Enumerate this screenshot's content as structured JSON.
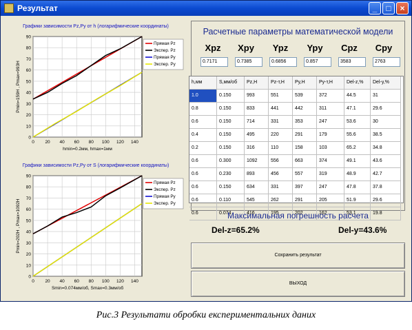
{
  "window": {
    "title": "Результат"
  },
  "titlebar_buttons": {
    "minimize": "_",
    "maximize": "□",
    "close": "×"
  },
  "chart_top": {
    "title": "Графики зависимости Pz,Py от h (логарифмические координаты)",
    "ylabel": "Pmin=159Н , Pmax=993Н",
    "xlabel": "hmin=0.2мм, hmax=1мм",
    "xticks": [
      "0",
      "20",
      "40",
      "60",
      "80",
      "100",
      "120",
      "140"
    ],
    "yticks": [
      "90",
      "80",
      "70",
      "60",
      "50",
      "40",
      "30",
      "20",
      "10",
      "0"
    ],
    "legend": [
      "Прямая Pz",
      "Экспер. Pz",
      "Прямая Py",
      "Экспер. Py"
    ]
  },
  "chart_bottom": {
    "title": "Графики зависимости Pz,Py от S (логарифмические координаты)",
    "ylabel": "Pmin=202Н , Pmax=1092Н",
    "xlabel": "Smin=0.074мм/об, Smax=0.3мм/об",
    "xticks": [
      "0",
      "20",
      "40",
      "60",
      "80",
      "100",
      "120",
      "140"
    ],
    "yticks": [
      "90",
      "80",
      "70",
      "60",
      "50",
      "40",
      "30",
      "20",
      "10",
      "0"
    ],
    "legend": [
      "Прямая Pz",
      "Экспер. Pz",
      "Прямая Py",
      "Экспер. Py"
    ]
  },
  "chart_data": [
    {
      "type": "line",
      "title": "Графики зависимости Pz,Py от h (логарифмические координаты)",
      "xlabel": "hmin=0.2мм, hmax=1мм",
      "ylabel": "Pmin=159Н , Pmax=993Н",
      "xlim": [
        0,
        150
      ],
      "ylim": [
        0,
        90
      ],
      "grid": true,
      "legend": "top-right",
      "series": [
        {
          "name": "Прямая Pz",
          "color": "#e00000",
          "x": [
            0,
            150
          ],
          "y": [
            34,
            90
          ]
        },
        {
          "name": "Экспер. Pz",
          "color": "#000000",
          "x": [
            0,
            20,
            40,
            60,
            80,
            100,
            120,
            150
          ],
          "y": [
            34,
            40,
            48,
            55,
            64,
            73,
            79,
            90
          ]
        },
        {
          "name": "Прямая Py",
          "color": "#1010d0",
          "x": [
            0,
            150
          ],
          "y": [
            0,
            58
          ]
        },
        {
          "name": "Экспер. Py",
          "color": "#e8e800",
          "x": [
            0,
            30,
            60,
            90,
            120,
            150
          ],
          "y": [
            0,
            12,
            23,
            35,
            46,
            58
          ]
        }
      ]
    },
    {
      "type": "line",
      "title": "Графики зависимости Pz,Py от S (логарифмические координаты)",
      "xlabel": "Smin=0.074мм/об, Smax=0.3мм/об",
      "ylabel": "Pmin=202Н , Pmax=1092Н",
      "xlim": [
        0,
        150
      ],
      "ylim": [
        0,
        90
      ],
      "grid": true,
      "legend": "top-right",
      "series": [
        {
          "name": "Прямая Pz",
          "color": "#e00000",
          "x": [
            0,
            150
          ],
          "y": [
            38,
            90
          ]
        },
        {
          "name": "Экспер. Pz",
          "color": "#000000",
          "x": [
            0,
            20,
            40,
            60,
            80,
            100,
            120,
            150
          ],
          "y": [
            38,
            45,
            53,
            57,
            62,
            72,
            79,
            90
          ]
        },
        {
          "name": "Прямая Py",
          "color": "#1010d0",
          "x": [
            0,
            150
          ],
          "y": [
            0,
            65
          ]
        },
        {
          "name": "Экспер. Py",
          "color": "#e8e800",
          "x": [
            0,
            30,
            60,
            90,
            120,
            150
          ],
          "y": [
            0,
            13,
            26,
            39,
            52,
            65
          ]
        }
      ]
    }
  ],
  "params": {
    "title": "Расчетные параметры математической модели",
    "labels": [
      "Xpz",
      "Xpy",
      "Ypz",
      "Ypy",
      "Cpz",
      "Cpy"
    ],
    "values": [
      "0.7171",
      "0.7385",
      "0.6856",
      "0.857",
      "3583",
      "2763"
    ]
  },
  "table": {
    "headers": [
      "h,мм",
      "S,мм/об",
      "Pz,Н",
      "Pz-т,Н",
      "Py,Н",
      "Py-т,Н",
      "Del-z,%",
      "Del-y,%"
    ],
    "rows": [
      [
        "1.0",
        "0.150",
        "993",
        "551",
        "539",
        "372",
        "44.5",
        "31"
      ],
      [
        "0.8",
        "0.150",
        "833",
        "441",
        "442",
        "311",
        "47.1",
        "29.6"
      ],
      [
        "0.6",
        "0.150",
        "714",
        "331",
        "353",
        "247",
        "53.6",
        "30"
      ],
      [
        "0.4",
        "0.150",
        "495",
        "220",
        "291",
        "179",
        "55.6",
        "38.5"
      ],
      [
        "0.2",
        "0.150",
        "316",
        "110",
        "158",
        "103",
        "65.2",
        "34.8"
      ],
      [
        "0.6",
        "0.300",
        "1092",
        "556",
        "663",
        "374",
        "49.1",
        "43.6"
      ],
      [
        "0.6",
        "0.230",
        "893",
        "456",
        "557",
        "319",
        "48.9",
        "42.7"
      ],
      [
        "0.6",
        "0.150",
        "634",
        "331",
        "397",
        "247",
        "47.8",
        "37.8"
      ],
      [
        "0.6",
        "0.110",
        "545",
        "262",
        "291",
        "205",
        "51.9",
        "29.6"
      ],
      [
        "0.6",
        "0.074",
        "416",
        "195",
        "202",
        "162",
        "53.1",
        "19.8"
      ]
    ]
  },
  "errors": {
    "title": "Максимальная погрешность расчета",
    "del_z": "Del-z=65.2%",
    "del_y": "Del-y=43.6%"
  },
  "buttons": {
    "save": "Сохранить результат",
    "exit": "ВЫХОД"
  },
  "caption": "Рис.3 Результати обробки експериментальних даних"
}
